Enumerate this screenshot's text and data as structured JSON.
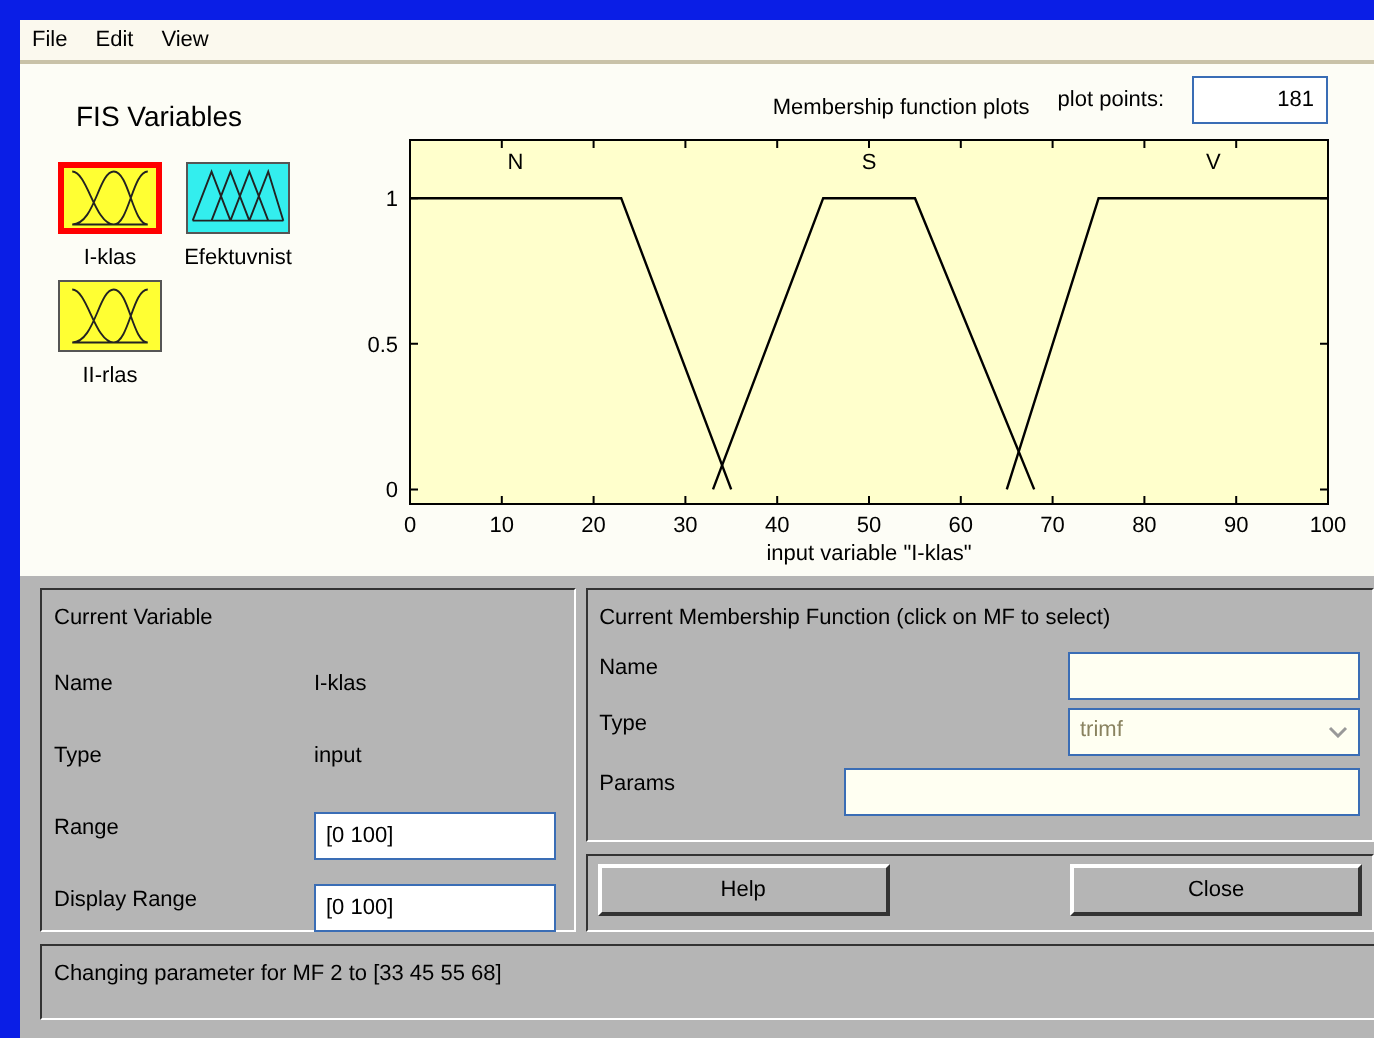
{
  "menu": [
    "File",
    "Edit",
    "View"
  ],
  "fis_variables": {
    "title": "FIS Variables",
    "items": [
      {
        "label": "I-klas",
        "kind": "input",
        "selected": true
      },
      {
        "label": "Efektuvnist",
        "kind": "output",
        "selected": false
      },
      {
        "label": "II-rlas",
        "kind": "input",
        "selected": false
      }
    ]
  },
  "plot": {
    "title": "Membership function plots",
    "plot_points_label": "plot points:",
    "plot_points": "181",
    "chart_data": {
      "type": "line",
      "xlabel": "input variable \"I-klas\"",
      "x": [
        0,
        23,
        33,
        35,
        45,
        55,
        65,
        68,
        75,
        100
      ],
      "series": [
        {
          "name": "N",
          "color": "#000000",
          "values": [
            1,
            1,
            null,
            0,
            null,
            null,
            null,
            null,
            null,
            null
          ]
        },
        {
          "name": "S",
          "color": "#000000",
          "values": [
            null,
            null,
            0,
            null,
            1,
            1,
            null,
            0,
            null,
            null
          ]
        },
        {
          "name": "V",
          "color": "#000000",
          "values": [
            null,
            null,
            null,
            null,
            null,
            null,
            0,
            null,
            1,
            1
          ]
        }
      ],
      "xlim": [
        0,
        100
      ],
      "ylim": [
        -0.05,
        1.2
      ],
      "xticks": [
        0,
        10,
        20,
        30,
        40,
        50,
        60,
        70,
        80,
        90,
        100
      ],
      "yticks": [
        0,
        0.5,
        1
      ],
      "legend": "top"
    }
  },
  "current_variable": {
    "title": "Current Variable",
    "rows": [
      {
        "label": "Name",
        "kind": "text",
        "value": "I-klas"
      },
      {
        "label": "Type",
        "kind": "text",
        "value": "input"
      },
      {
        "label": "Range",
        "kind": "field",
        "value": "[0 100]"
      },
      {
        "label": "Display Range",
        "kind": "field",
        "value": "[0 100]"
      }
    ]
  },
  "current_mf": {
    "title": "Current Membership Function (click on MF to select)",
    "name_label": "Name",
    "type_label": "Type",
    "type_value": "trimf",
    "params_label": "Params"
  },
  "buttons": [
    "Help",
    "Close"
  ],
  "status": "Changing parameter for MF 2 to  [33 45 55 68]"
}
